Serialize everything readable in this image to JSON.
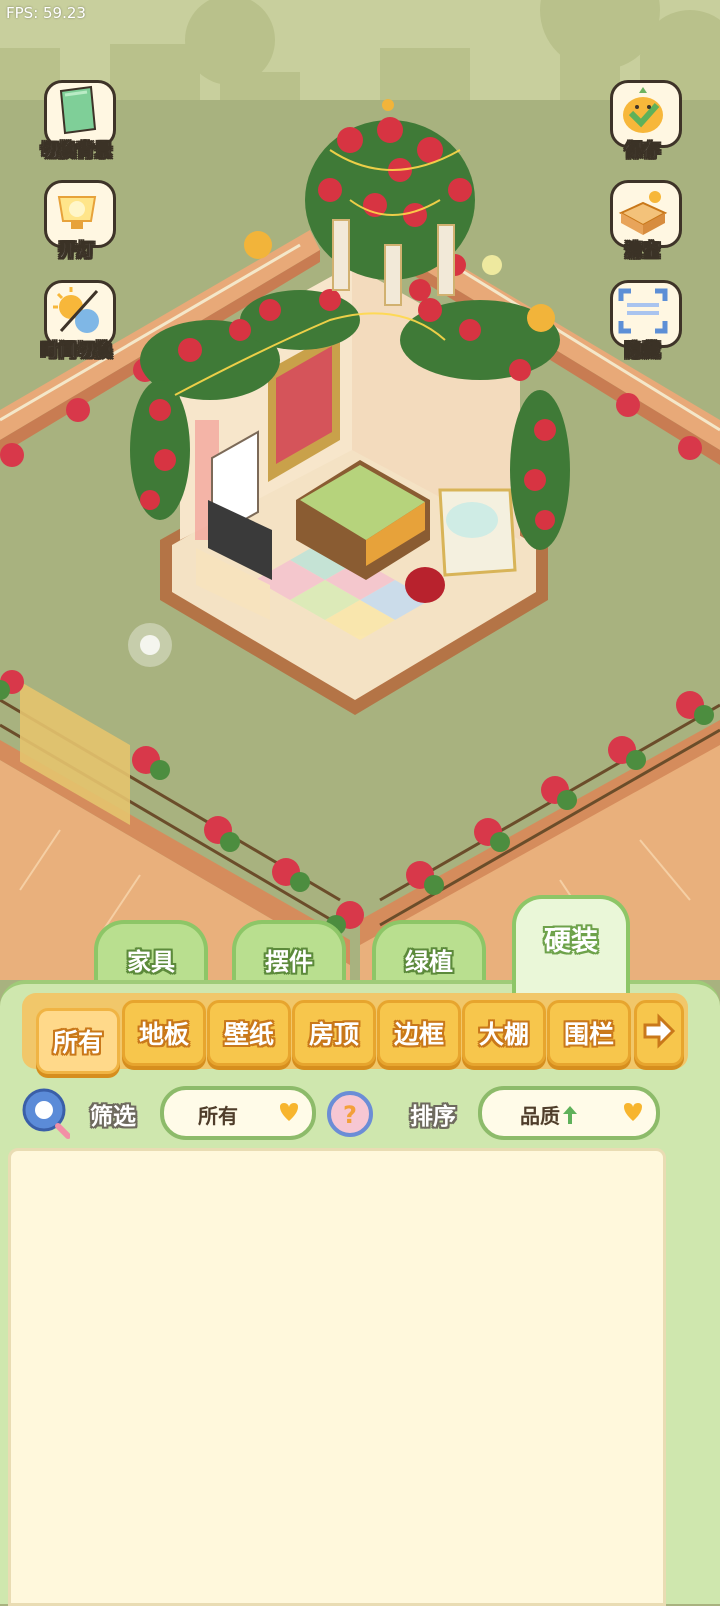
{
  "hud": {
    "fps": "FPS: 59.23"
  },
  "left_buttons": [
    {
      "label": "切换背景",
      "icon": "background-switch-icon"
    },
    {
      "label": "开灯",
      "icon": "lamp-icon"
    },
    {
      "label": "时间切换",
      "icon": "sun-moon-icon"
    }
  ],
  "right_buttons": [
    {
      "label": "保存",
      "icon": "chick-save-icon"
    },
    {
      "label": "清空",
      "icon": "box-clear-icon"
    },
    {
      "label": "隐藏",
      "icon": "hide-frame-icon"
    }
  ],
  "category_tabs": [
    {
      "label": "家具",
      "active": false
    },
    {
      "label": "摆件",
      "active": false
    },
    {
      "label": "绿植",
      "active": false
    },
    {
      "label": "硬装",
      "active": true
    }
  ],
  "sub_tabs": [
    {
      "label": "所有",
      "active": true
    },
    {
      "label": "地板",
      "active": false
    },
    {
      "label": "壁纸",
      "active": false
    },
    {
      "label": "房顶",
      "active": false
    },
    {
      "label": "边框",
      "active": false
    },
    {
      "label": "大棚",
      "active": false
    },
    {
      "label": "围栏",
      "active": false
    }
  ],
  "filter": {
    "search_icon": "search-icon",
    "filter_label": "筛选",
    "filter_value": "所有",
    "help_icon": "question-icon",
    "sort_label": "排序",
    "sort_value": "品质",
    "sort_direction_icon": "arrow-up-icon"
  },
  "colors": {
    "grass": "#a8b27f",
    "panel": "#cfe7ae",
    "tab_orange": "#f7c64c",
    "list_bg": "#fff8dc"
  }
}
